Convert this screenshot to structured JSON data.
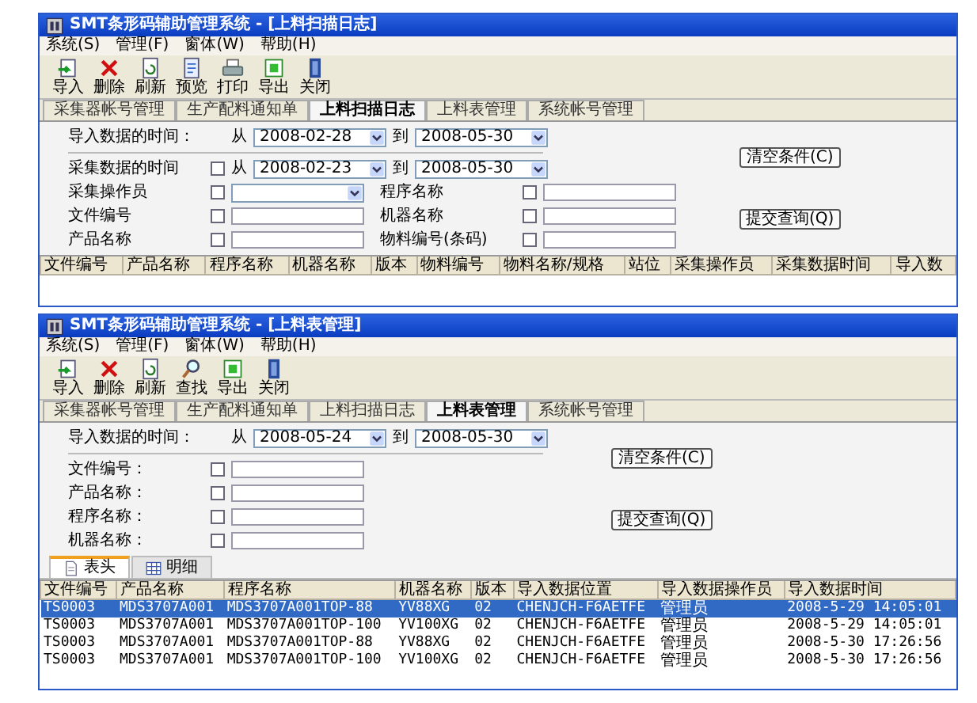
{
  "windows": [
    {
      "title": "SMT条形码辅助管理系统 - [上料扫描日志]",
      "menu": [
        "系统(S)",
        "管理(F)",
        "窗体(W)",
        "帮助(H)"
      ],
      "toolbar": [
        {
          "kind": "import",
          "label": "导入"
        },
        {
          "kind": "delete",
          "label": "删除"
        },
        {
          "kind": "refresh",
          "label": "刷新"
        },
        {
          "kind": "preview",
          "label": "预览"
        },
        {
          "kind": "print",
          "label": "打印"
        },
        {
          "kind": "export",
          "label": "导出"
        },
        {
          "kind": "close",
          "label": "关闭"
        }
      ],
      "tabs": [
        {
          "label": "采集器帐号管理",
          "selected": false
        },
        {
          "label": "生产配料通知单",
          "selected": false
        },
        {
          "label": "上料扫描日志",
          "selected": true
        },
        {
          "label": "上料表管理",
          "selected": false
        },
        {
          "label": "系统帐号管理",
          "selected": false
        }
      ],
      "form": {
        "rows": [
          {
            "divider_after": true,
            "fields": [
              {
                "kind": "daterange",
                "label": "导入数据的时间：",
                "from_label": "从",
                "from": "2008-02-28",
                "to_label": "到",
                "to": "2008-05-30"
              }
            ]
          },
          {
            "divider_after": false,
            "fields": [
              {
                "kind": "daterange",
                "label": "采集数据的时间",
                "checked": false,
                "from_label": "从",
                "from": "2008-02-23",
                "to_label": "到",
                "to": "2008-05-30"
              }
            ]
          },
          {
            "divider_after": false,
            "fields": [
              {
                "kind": "select",
                "label": "采集操作员",
                "checked": false
              },
              {
                "kind": "text",
                "label": "程序名称",
                "checked": false
              }
            ]
          },
          {
            "divider_after": false,
            "fields": [
              {
                "kind": "text",
                "label": "文件编号",
                "checked": false
              },
              {
                "kind": "text",
                "label": "机器名称",
                "checked": false
              }
            ]
          },
          {
            "divider_after": false,
            "fields": [
              {
                "kind": "text",
                "label": "产品名称",
                "checked": false
              },
              {
                "kind": "text",
                "label": "物料编号(条码)",
                "checked": false
              }
            ]
          }
        ],
        "buttons": [
          "清空条件(C)",
          "提交查询(Q)"
        ]
      },
      "table": {
        "columns": [
          "文件编号",
          "产品名称",
          "程序名称",
          "机器名称",
          "版本",
          "物料编号",
          "物料名称/规格",
          "站位",
          "采集操作员",
          "采集数据时间",
          "导入数"
        ]
      }
    },
    {
      "title": "SMT条形码辅助管理系统 - [上料表管理]",
      "menu": [
        "系统(S)",
        "管理(F)",
        "窗体(W)",
        "帮助(H)"
      ],
      "toolbar": [
        {
          "kind": "import",
          "label": "导入"
        },
        {
          "kind": "delete",
          "label": "删除"
        },
        {
          "kind": "refresh",
          "label": "刷新"
        },
        {
          "kind": "find",
          "label": "查找"
        },
        {
          "kind": "export",
          "label": "导出"
        },
        {
          "kind": "close",
          "label": "关闭"
        }
      ],
      "tabs": [
        {
          "label": "采集器帐号管理",
          "selected": false
        },
        {
          "label": "生产配料通知单",
          "selected": false
        },
        {
          "label": "上料扫描日志",
          "selected": false
        },
        {
          "label": "上料表管理",
          "selected": true
        },
        {
          "label": "系统帐号管理",
          "selected": false
        }
      ],
      "form": {
        "rows": [
          {
            "divider_after": true,
            "fields": [
              {
                "kind": "daterange",
                "label": "导入数据的时间：",
                "from_label": "从",
                "from": "2008-05-24",
                "to_label": "到",
                "to": "2008-05-30"
              }
            ]
          },
          {
            "divider_after": false,
            "fields": [
              {
                "kind": "text",
                "label": "文件编号：",
                "checked": false
              }
            ]
          },
          {
            "divider_after": false,
            "fields": [
              {
                "kind": "text",
                "label": "产品名称：",
                "checked": false
              }
            ]
          },
          {
            "divider_after": false,
            "fields": [
              {
                "kind": "text",
                "label": "程序名称：",
                "checked": false
              }
            ]
          },
          {
            "divider_after": false,
            "fields": [
              {
                "kind": "text",
                "label": "机器名称：",
                "checked": false
              }
            ]
          }
        ],
        "buttons": [
          "清空条件(C)",
          "提交查询(Q)"
        ]
      },
      "subtabs": [
        {
          "kind": "document",
          "label": "表头",
          "selected": true
        },
        {
          "kind": "grid",
          "label": "明细",
          "selected": false
        }
      ],
      "table": {
        "columns": [
          "文件编号",
          "产品名称",
          "程序名称",
          "机器名称",
          "版本",
          "导入数据位置",
          "导入数据操作员",
          "导入数据时间"
        ],
        "rows": [
          {
            "selected": true,
            "cells": [
              "TS0003",
              "MDS3707A001",
              "MDS3707A001TOP-88",
              "YV88XG",
              "02",
              "CHENJCH-F6AETFE",
              "管理员",
              "2008-5-29 14:05:01"
            ]
          },
          {
            "selected": false,
            "cells": [
              "TS0003",
              "MDS3707A001",
              "MDS3707A001TOP-100",
              "YV100XG",
              "02",
              "CHENJCH-F6AETFE",
              "管理员",
              "2008-5-29 14:05:01"
            ]
          },
          {
            "selected": false,
            "cells": [
              "TS0003",
              "MDS3707A001",
              "MDS3707A001TOP-88",
              "YV88XG",
              "02",
              "CHENJCH-F6AETFE",
              "管理员",
              "2008-5-30 17:26:56"
            ]
          },
          {
            "selected": false,
            "cells": [
              "TS0003",
              "MDS3707A001",
              "MDS3707A001TOP-100",
              "YV100XG",
              "02",
              "CHENJCH-F6AETFE",
              "管理员",
              "2008-5-30 17:26:56"
            ]
          }
        ]
      }
    }
  ]
}
